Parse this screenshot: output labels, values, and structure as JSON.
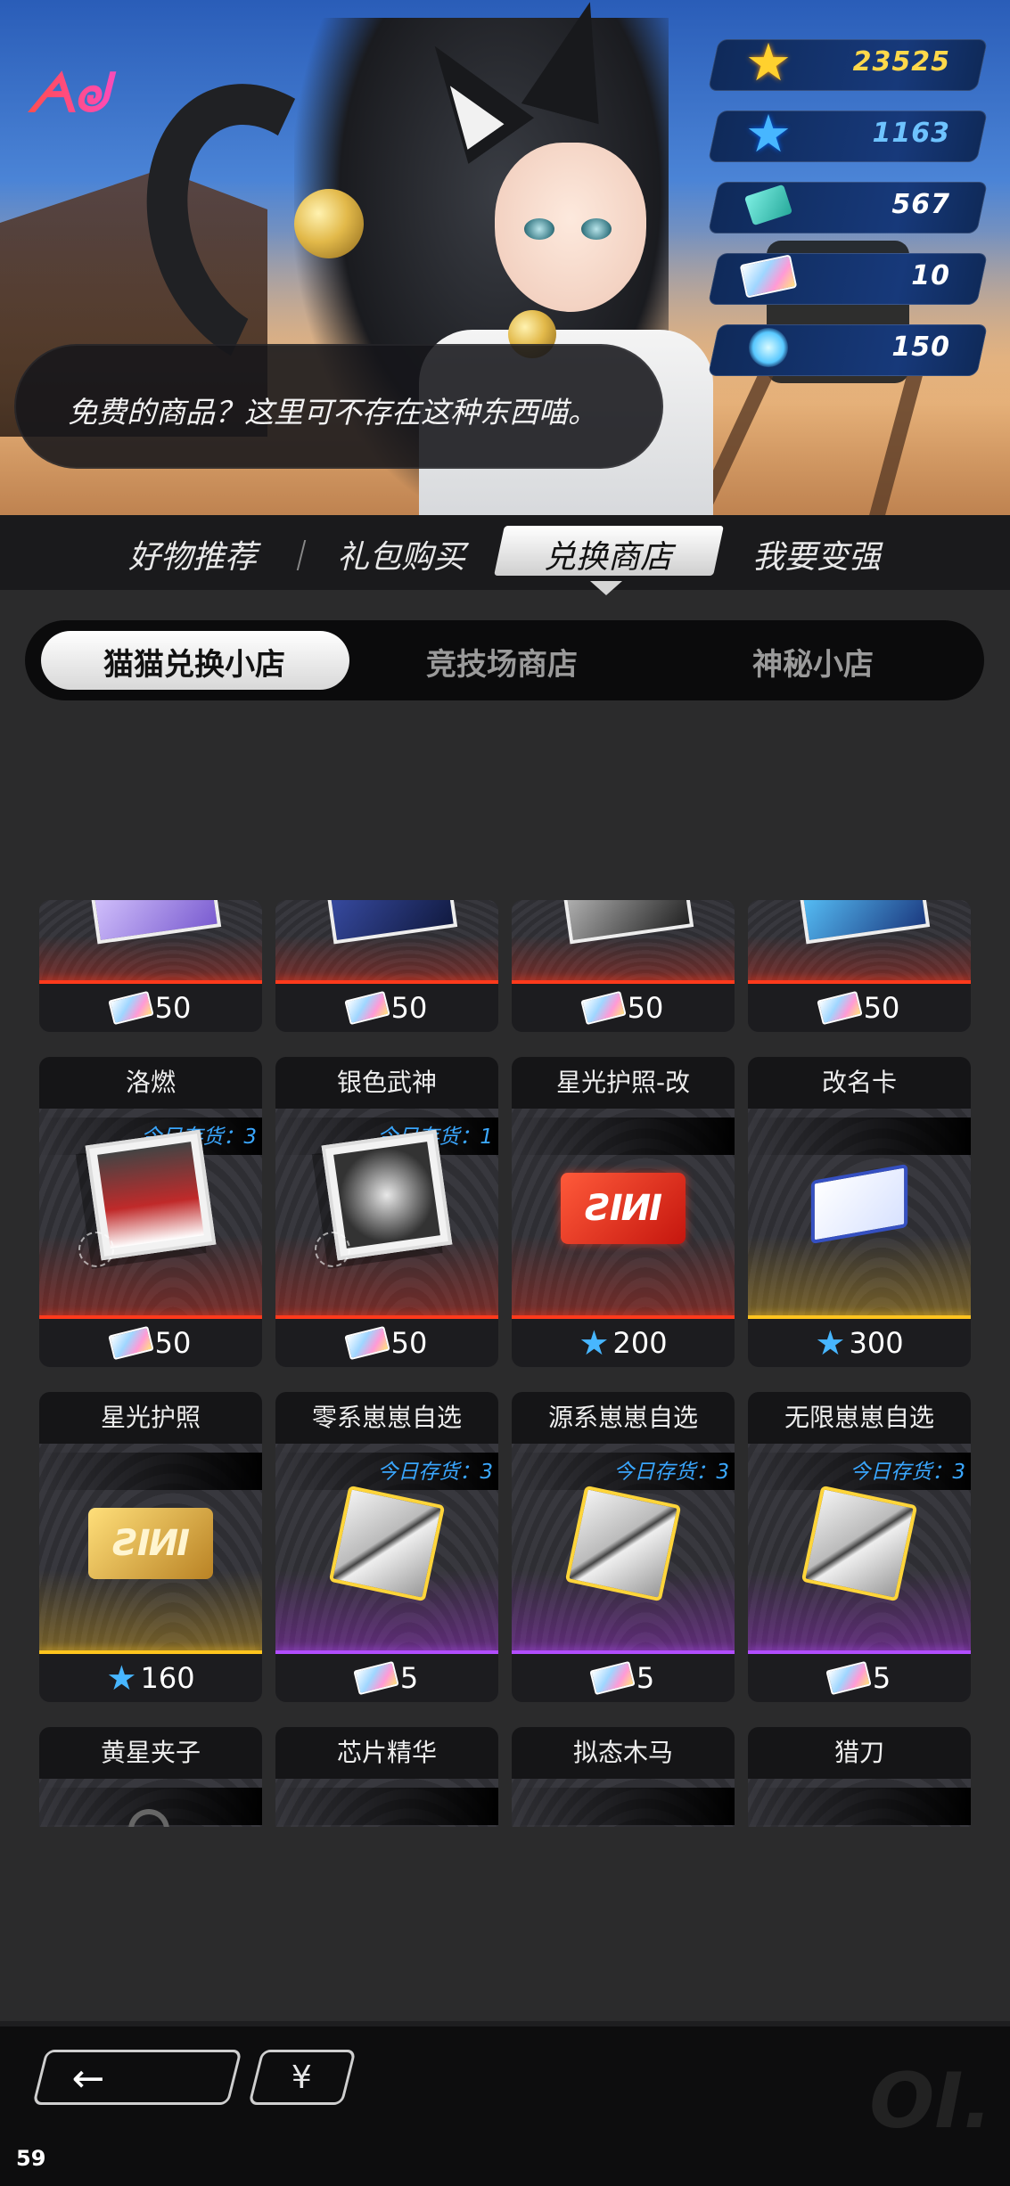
{
  "currencies": [
    {
      "icon": "gold-star-icon",
      "value": "23525"
    },
    {
      "icon": "blue-star-icon",
      "value": "1163"
    },
    {
      "icon": "ticket-icon",
      "value": "567"
    },
    {
      "icon": "card-pack-icon",
      "value": "10"
    },
    {
      "icon": "crystal-icon",
      "value": "150"
    }
  ],
  "logo": {
    "text": "ᗅᖙ"
  },
  "bubble": {
    "text": "免费的商品？这里可不存在这种东西喵。"
  },
  "main_tabs": [
    "好物推荐",
    "礼包购买",
    "兑换商店",
    "我要变强"
  ],
  "main_tab_active": "兑换商店",
  "sub_tabs": [
    "猫猫兑换小店",
    "竞技场商店",
    "神秘小店"
  ],
  "sub_tab_active": "猫猫兑换小店",
  "top_row": [
    {
      "price": "50",
      "currency": "card-pack-icon"
    },
    {
      "price": "50",
      "currency": "card-pack-icon"
    },
    {
      "price": "50",
      "currency": "card-pack-icon"
    },
    {
      "price": "50",
      "currency": "card-pack-icon"
    }
  ],
  "row2": [
    {
      "title": "洛燃",
      "stock": "今日存货：3",
      "price": "50",
      "currency": "card-pack-icon"
    },
    {
      "title": "银色武神",
      "stock": "今日存货：1",
      "price": "50",
      "currency": "card-pack-icon"
    },
    {
      "title": "星光护照-改",
      "stock": "",
      "price": "200",
      "currency": "blue-star-icon"
    },
    {
      "title": "改名卡",
      "stock": "",
      "price": "300",
      "currency": "blue-star-icon"
    }
  ],
  "row3": [
    {
      "title": "星光护照",
      "stock": "",
      "price": "160",
      "currency": "blue-star-icon"
    },
    {
      "title": "零系崽崽自选",
      "stock": "今日存货：3",
      "price": "5",
      "currency": "card-pack-icon"
    },
    {
      "title": "源系崽崽自选",
      "stock": "今日存货：3",
      "price": "5",
      "currency": "card-pack-icon"
    },
    {
      "title": "无限崽崽自选",
      "stock": "今日存货：3",
      "price": "5",
      "currency": "card-pack-icon"
    }
  ],
  "row4": [
    {
      "title": "黄星夹子"
    },
    {
      "title": "芯片精华"
    },
    {
      "title": "拟态木马"
    },
    {
      "title": "猎刀"
    }
  ],
  "passport_text": "ƧIИI",
  "footer": {
    "back_label": "←",
    "yen_label": "¥",
    "deco": "OI."
  },
  "fps": "59"
}
